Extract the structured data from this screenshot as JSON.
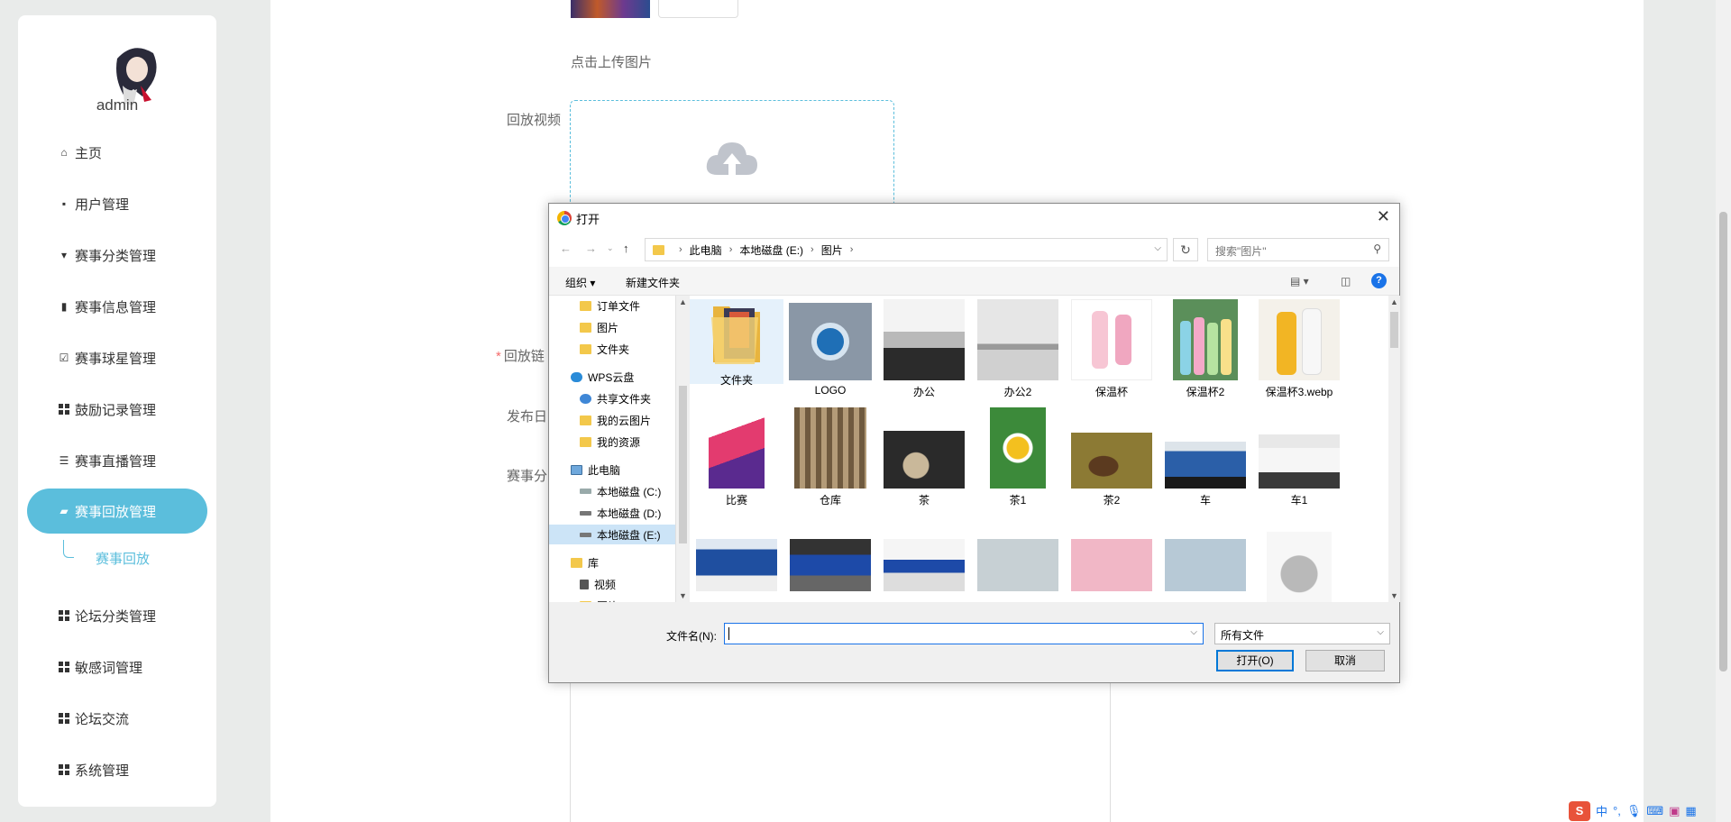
{
  "sidebar": {
    "username": "admin",
    "items": [
      {
        "label": "主页",
        "icon": "home-icon"
      },
      {
        "label": "用户管理",
        "icon": "user-icon"
      },
      {
        "label": "赛事分类管理",
        "icon": "category-icon"
      },
      {
        "label": "赛事信息管理",
        "icon": "chart-icon"
      },
      {
        "label": "赛事球星管理",
        "icon": "clipboard-icon"
      },
      {
        "label": "鼓励记录管理",
        "icon": "grid-icon"
      },
      {
        "label": "赛事直播管理",
        "icon": "sliders-icon"
      },
      {
        "label": "赛事回放管理",
        "icon": "camera-icon"
      },
      {
        "label": "论坛分类管理",
        "icon": "grid-icon"
      },
      {
        "label": "敏感词管理",
        "icon": "grid-icon"
      },
      {
        "label": "论坛交流",
        "icon": "grid-icon"
      },
      {
        "label": "系统管理",
        "icon": "grid-icon"
      }
    ],
    "sub_item": "赛事回放"
  },
  "form": {
    "upload_tip": "点击上传图片",
    "label_replay_video": "回放视频",
    "label_replay_link": "回放链",
    "label_publish_date": "发布日",
    "label_category": "赛事分",
    "required_mark": "*"
  },
  "dialog": {
    "title": "打开",
    "close": "✕",
    "breadcrumb": [
      "此电脑",
      "本地磁盘 (E:)",
      "图片"
    ],
    "search_placeholder": "搜索\"图片\"",
    "cmd_organize": "组织 ▾",
    "cmd_new_folder": "新建文件夹",
    "help": "?",
    "tree": [
      {
        "label": "订单文件",
        "type": "folder"
      },
      {
        "label": "图片",
        "type": "folder"
      },
      {
        "label": "文件夹",
        "type": "folder"
      },
      {
        "label": "WPS云盘",
        "type": "cloud"
      },
      {
        "label": "共享文件夹",
        "type": "share"
      },
      {
        "label": "我的云图片",
        "type": "folder"
      },
      {
        "label": "我的资源",
        "type": "folder"
      },
      {
        "label": "此电脑",
        "type": "pc"
      },
      {
        "label": "本地磁盘 (C:)",
        "type": "drive"
      },
      {
        "label": "本地磁盘 (D:)",
        "type": "drive"
      },
      {
        "label": "本地磁盘 (E:)",
        "type": "drive"
      },
      {
        "label": "库",
        "type": "library"
      },
      {
        "label": "视频",
        "type": "video"
      },
      {
        "label": "图片",
        "type": "folder"
      }
    ],
    "files_row1": [
      "文件夹",
      "LOGO",
      "办公",
      "办公2",
      "保温杯",
      "保温杯2",
      "保温杯3.webp"
    ],
    "files_row2": [
      "比赛",
      "仓库",
      "茶",
      "茶1",
      "茶2",
      "车",
      "车1"
    ],
    "filename_label": "文件名(N):",
    "filename_value": "",
    "filetype": "所有文件",
    "btn_open": "打开(O)",
    "btn_cancel": "取消"
  },
  "ime": {
    "brand": "S",
    "mode": "中",
    "punct": "°,"
  }
}
